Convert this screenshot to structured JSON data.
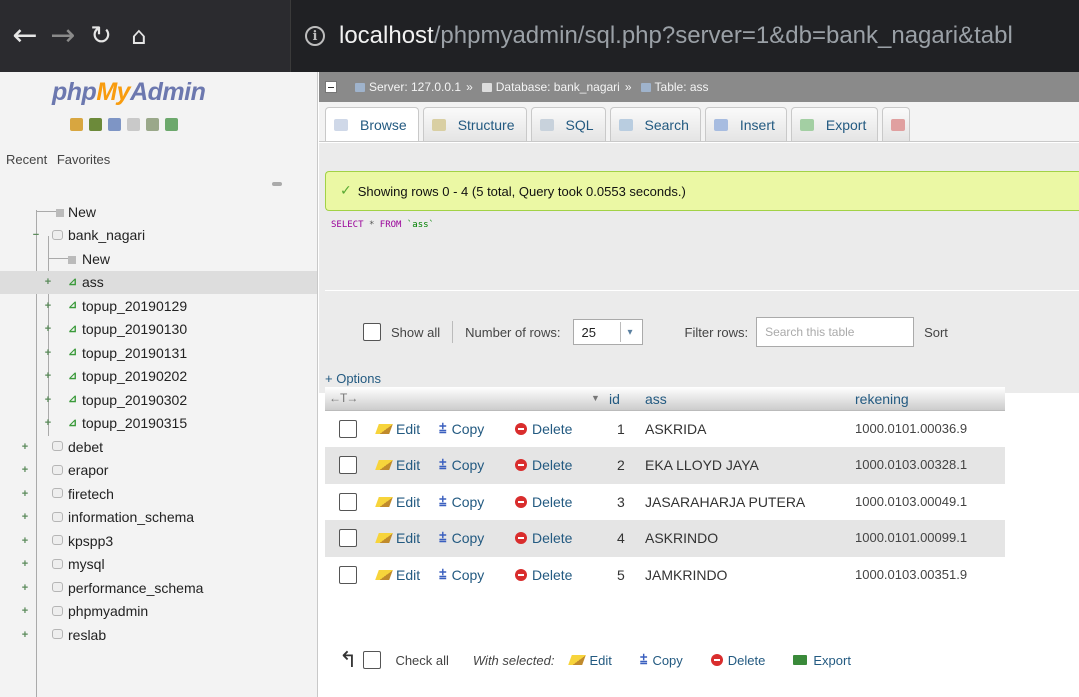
{
  "browser": {
    "url_host": "localhost",
    "url_path": "/phpmyadmin/sql.php?server=1&db=bank_nagari&tabl"
  },
  "sidebar": {
    "logo_php": "php",
    "logo_my": "My",
    "logo_admin": "Admin",
    "recent": "Recent",
    "favorites": "Favorites",
    "new": "New",
    "db_open": "bank_nagari",
    "db_new": "New",
    "tables": [
      "ass",
      "topup_20190129",
      "topup_20190130",
      "topup_20190131",
      "topup_20190202",
      "topup_20190302",
      "topup_20190315"
    ],
    "databases": [
      "debet",
      "erapor",
      "firetech",
      "information_schema",
      "kpspp3",
      "mysql",
      "performance_schema",
      "phpmyadmin",
      "reslab"
    ]
  },
  "breadcrumb": {
    "server": "Server: 127.0.0.1",
    "database": "Database: bank_nagari",
    "table": "Table: ass"
  },
  "tabs": [
    "Browse",
    "Structure",
    "SQL",
    "Search",
    "Insert",
    "Export"
  ],
  "message": "Showing rows 0 - 4 (5 total, Query took 0.0553 seconds.)",
  "sql": {
    "select": "SELECT",
    "star": "*",
    "from": "FROM",
    "table": "`ass`"
  },
  "controls": {
    "show_all": "Show all",
    "number_of_rows": "Number of rows:",
    "rows_value": "25",
    "filter_rows": "Filter rows:",
    "filter_placeholder": "Search this table",
    "sort": "Sort"
  },
  "options": "+ Options",
  "table": {
    "columns": [
      "id",
      "ass",
      "rekening"
    ],
    "actions": {
      "edit": "Edit",
      "copy": "Copy",
      "delete": "Delete"
    },
    "rows": [
      {
        "id": "1",
        "ass": "ASKRIDA",
        "rekening": "1000.0101.00036.9"
      },
      {
        "id": "2",
        "ass": "EKA LLOYD JAYA",
        "rekening": "1000.0103.00328.1"
      },
      {
        "id": "3",
        "ass": "JASARAHARJA PUTERA",
        "rekening": "1000.0103.00049.1"
      },
      {
        "id": "4",
        "ass": "ASKRINDO",
        "rekening": "1000.0101.00099.1"
      },
      {
        "id": "5",
        "ass": "JAMKRINDO",
        "rekening": "1000.0103.00351.9"
      }
    ]
  },
  "bottom": {
    "check_all": "Check all",
    "with_selected": "With selected:",
    "edit": "Edit",
    "copy": "Copy",
    "delete": "Delete",
    "export": "Export"
  },
  "icons": {
    "back": "arrow-left-icon",
    "forward": "arrow-right-icon",
    "reload": "reload-icon",
    "home": "home-icon",
    "info": "info-icon"
  },
  "colors": {
    "link": "#235a81",
    "success_bg": "#ebf8a4",
    "logo_blue": "#6c78af",
    "logo_orange": "#f89c0e"
  }
}
